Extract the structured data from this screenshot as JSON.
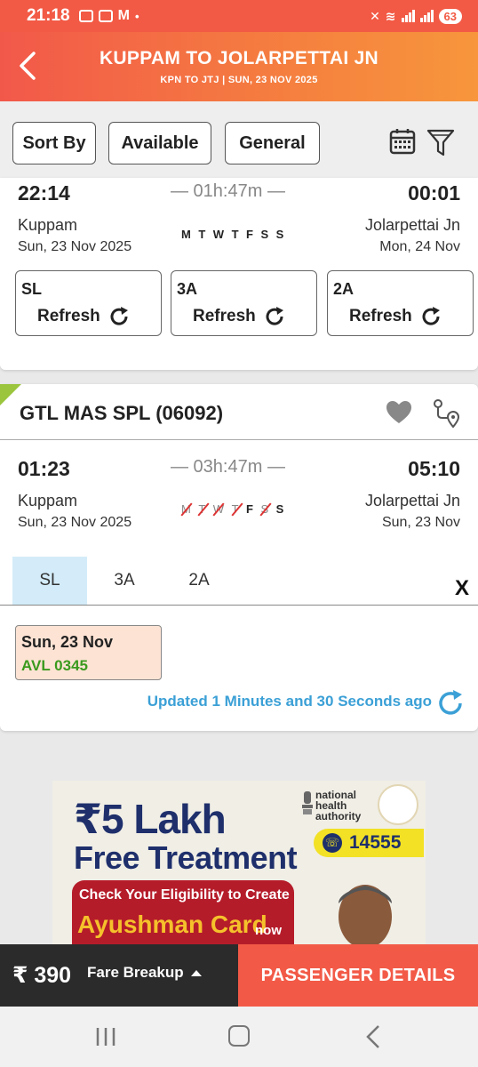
{
  "status_bar": {
    "time": "21:18",
    "battery": "63",
    "dot": "•"
  },
  "header": {
    "title": "KUPPAM TO JOLARPETTAI JN",
    "subtitle": "KPN TO JTJ | SUN, 23 NOV  2025"
  },
  "filters": {
    "sort_by": "Sort By",
    "available": "Available",
    "general": "General"
  },
  "train1": {
    "dep_time": "22:14",
    "arr_time": "00:01",
    "duration": "— 01h:47m —",
    "from_station": "Kuppam",
    "from_date": "Sun, 23 Nov  2025",
    "to_station": "Jolarpettai Jn",
    "to_date": "Mon, 24 Nov",
    "days": [
      {
        "d": "M",
        "runs": true
      },
      {
        "d": "T",
        "runs": true
      },
      {
        "d": "W",
        "runs": true
      },
      {
        "d": "T",
        "runs": true
      },
      {
        "d": "F",
        "runs": true
      },
      {
        "d": "S",
        "runs": true
      },
      {
        "d": "S",
        "runs": true
      }
    ],
    "classes": [
      {
        "name": "SL",
        "action": "Refresh"
      },
      {
        "name": "3A",
        "action": "Refresh"
      },
      {
        "name": "2A",
        "action": "Refresh"
      }
    ]
  },
  "train2": {
    "name": "GTL MAS SPL (06092)",
    "dep_time": "01:23",
    "arr_time": "05:10",
    "duration": "— 03h:47m —",
    "from_station": "Kuppam",
    "from_date": "Sun, 23 Nov  2025",
    "to_station": "Jolarpettai Jn",
    "to_date": "Sun, 23 Nov",
    "days": [
      {
        "d": "M",
        "runs": false
      },
      {
        "d": "T",
        "runs": false
      },
      {
        "d": "W",
        "runs": false
      },
      {
        "d": "T",
        "runs": false
      },
      {
        "d": "F",
        "runs": true
      },
      {
        "d": "S",
        "runs": false
      },
      {
        "d": "S",
        "runs": true
      }
    ],
    "tabs": [
      "SL",
      "3A",
      "2A"
    ],
    "active_tab": "SL",
    "close": "X",
    "availability": {
      "date": "Sun, 23 Nov",
      "status": "AVL 0345"
    },
    "updated": "Updated 1 Minutes and 30 Seconds ago"
  },
  "banner": {
    "line1": "₹5 Lakh",
    "line2": "Free Treatment",
    "nha": "national health authority",
    "phone": "14555",
    "check": "Check Your Eligibility to Create",
    "card": "Ayushman Card",
    "now": "now"
  },
  "footer": {
    "fare": "₹ 390",
    "fare_breakup": "Fare Breakup",
    "passenger_details": "PASSENGER DETAILS"
  },
  "colors": {
    "accent": "#f25a47",
    "header_gradient_end": "#f7963c",
    "available_green": "#3a9a1e",
    "updated_blue": "#3ba0d6",
    "tab_active_bg": "#d4ecf9"
  }
}
